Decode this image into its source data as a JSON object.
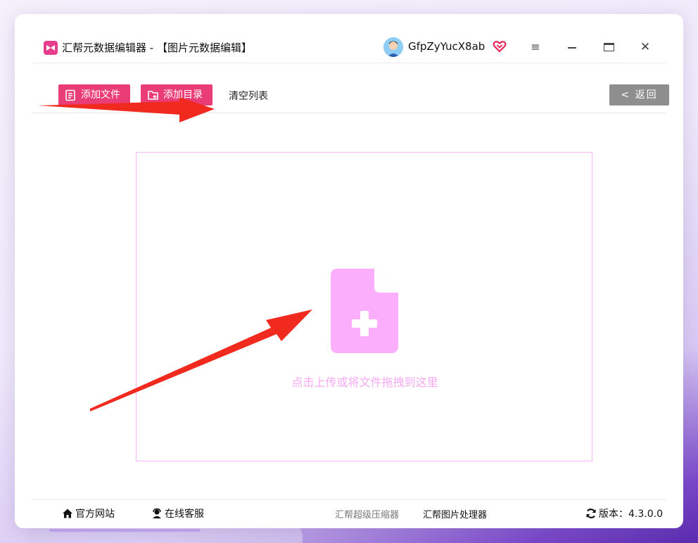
{
  "window": {
    "title": "汇帮元数据编辑器 - 【图片元数据编辑】",
    "user_name": "GfpZyYucX8ab",
    "controls": {
      "menu": "≡",
      "close": "✕"
    }
  },
  "toolbar": {
    "add_file_label": "添加文件",
    "add_dir_label": "添加目录",
    "clear_label": "清空列表",
    "back_label": "< 返回"
  },
  "dropzone": {
    "hint": "点击上传或将文件拖拽到这里"
  },
  "footer": {
    "official_site": "官方网站",
    "online_service": "在线客服",
    "compressor": "汇帮超级压缩器",
    "image_processor": "汇帮图片处理器",
    "version": "版本：4.3.0.0"
  },
  "colors": {
    "accent_pink": "#ea3d78",
    "dropzone_pink": "#f7a9f4",
    "annotation_red": "#f02a1e",
    "back_gray": "#8e8e8e"
  }
}
